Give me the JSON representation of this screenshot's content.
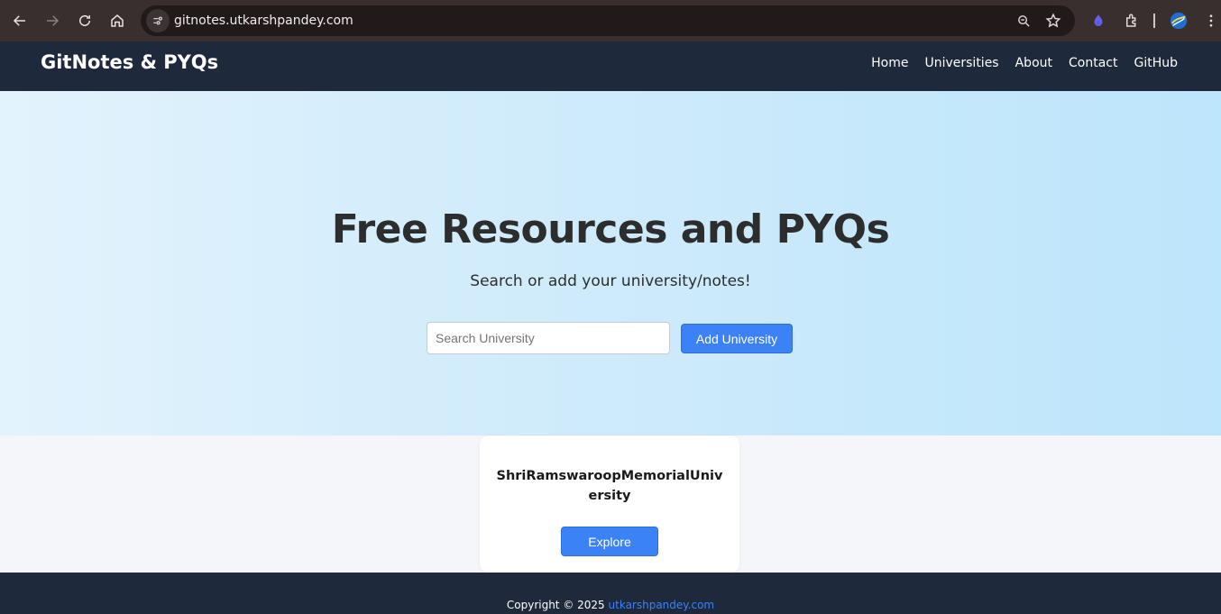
{
  "browser": {
    "url": "gitnotes.utkarshpandey.com",
    "icons": [
      "back-icon",
      "forward-icon",
      "reload-icon",
      "home-icon",
      "site-settings-icon",
      "zoom-icon",
      "bookmark-star-icon",
      "extension-drop-icon",
      "extensions-puzzle-icon",
      "profile-avatar-icon",
      "menu-dots-icon"
    ]
  },
  "navbar": {
    "brand": "GitNotes & PYQs",
    "links": [
      "Home",
      "Universities",
      "About",
      "Contact",
      "GitHub"
    ]
  },
  "hero": {
    "title": "Free Resources and PYQs",
    "subtitle": "Search or add your university/notes!",
    "search_placeholder": "Search University",
    "add_button": "Add University"
  },
  "universities": [
    {
      "name": "ShriRamswaroopMemorialUniversity",
      "button": "Explore"
    }
  ],
  "footer": {
    "copyright": "Copyright © 2025",
    "link_text": "utkarshpandey.com"
  },
  "colors": {
    "navbar_bg": "#1e293b",
    "accent": "#3b82f6",
    "browser_bg": "#3a2f2f"
  }
}
